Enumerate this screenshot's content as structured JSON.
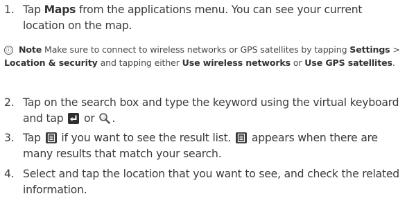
{
  "steps": [
    {
      "number": "1.",
      "text_a": "Tap ",
      "bold_a": "Maps",
      "text_b": " from the applications menu. You can see your current location on the map."
    },
    {
      "number": "2.",
      "text_a": "Tap on the search box and type the keyword using the virtual keyboard and tap ",
      "text_b": " or ",
      "text_c": "."
    },
    {
      "number": "3.",
      "text_a": "Tap ",
      "text_b": " if you want to see the result list. ",
      "text_c": " appears when there are many results that match your search."
    },
    {
      "number": "4.",
      "text_a": "Select and tap the location that you want to see, and check the related information."
    }
  ],
  "note": {
    "icon": "ⓘ",
    "label": "Note",
    "text_a": " Make sure to connect to wireless networks or GPS satellites by tapping ",
    "settings": "Settings",
    "sep": " > ",
    "location": "Location & security",
    "text_b": " and tapping either ",
    "use_wireless": "Use wireless networks",
    "text_c": " or ",
    "use_gps": "Use GPS satellites",
    "text_d": "."
  },
  "icons": {
    "enter": "enter-key-icon",
    "search": "search-magnifier-icon",
    "list": "list-view-icon"
  }
}
